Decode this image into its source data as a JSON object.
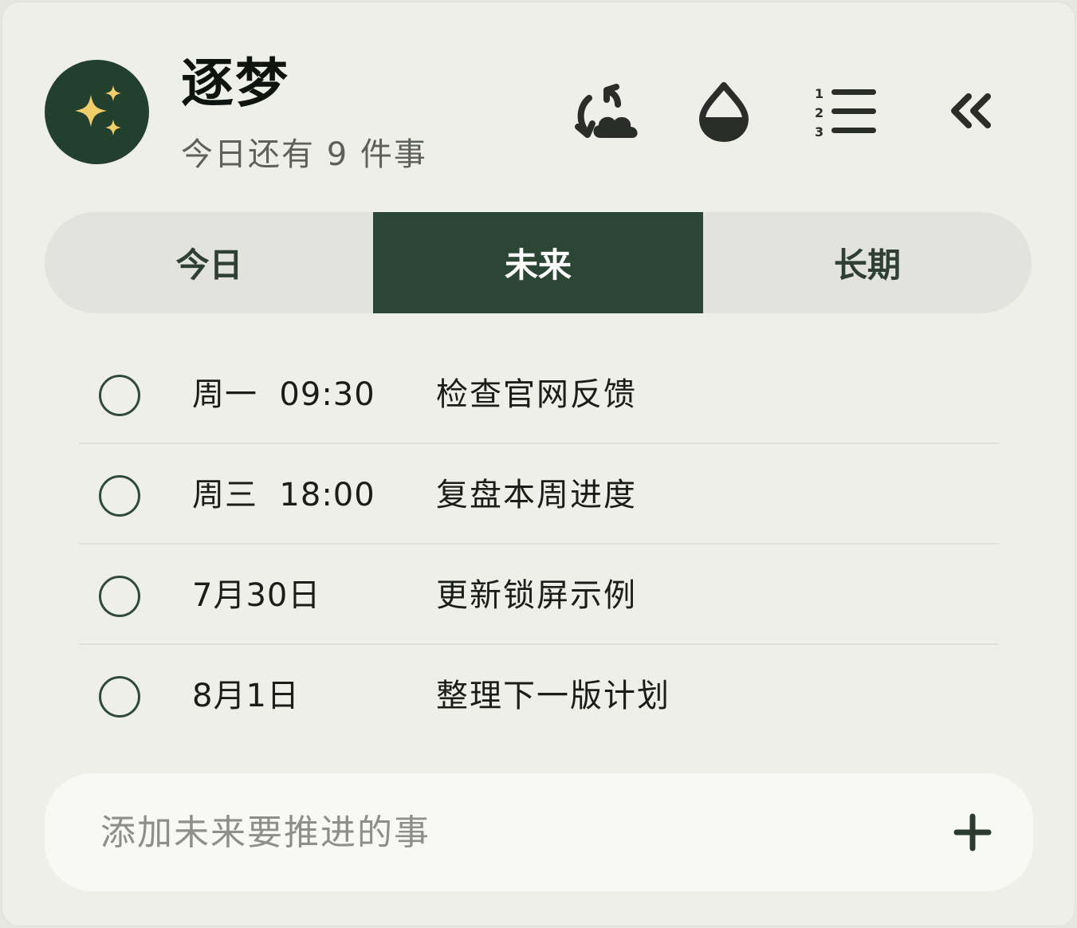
{
  "header": {
    "app_icon": "sparkles-icon",
    "title": "逐梦",
    "subtitle": "今日还有 9 件事",
    "actions": [
      {
        "name": "sync-cloud-icon"
      },
      {
        "name": "drop-icon"
      },
      {
        "name": "numbered-list-icon"
      },
      {
        "name": "double-chevron-left-icon"
      }
    ]
  },
  "tabs": [
    {
      "label": "今日",
      "active": false
    },
    {
      "label": "未来",
      "active": true
    },
    {
      "label": "长期",
      "active": false
    }
  ],
  "tasks": [
    {
      "when": "周一  09:30",
      "title": "检查官网反馈",
      "done": false
    },
    {
      "when": "周三  18:00",
      "title": "复盘本周进度",
      "done": false
    },
    {
      "when": "7月30日",
      "title": "更新锁屏示例",
      "done": false
    },
    {
      "when": "8月1日",
      "title": "整理下一版计划",
      "done": false
    }
  ],
  "add": {
    "placeholder": "添加未来要推进的事",
    "button_icon": "plus-icon"
  },
  "colors": {
    "accent": "#2b4634",
    "star": "#f0cf6a",
    "background": "#efefea"
  }
}
